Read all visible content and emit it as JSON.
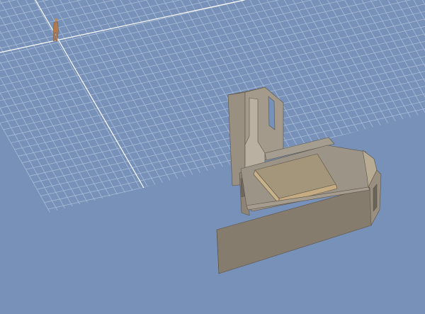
{
  "viewport": {
    "background_color": "#7891b8",
    "grid_line_color": "#a7bbd6",
    "axis_line_color": "#ffffff"
  },
  "scene": {
    "figure_color": "#b07a4c",
    "wall_front_color": "#8b8070",
    "wall_side_color": "#a69c8d",
    "roof_color": "#9a9284",
    "platform_color": "#a4967a",
    "platform_edge_color": "#c8b28a",
    "outline_color": "#5b5247"
  }
}
